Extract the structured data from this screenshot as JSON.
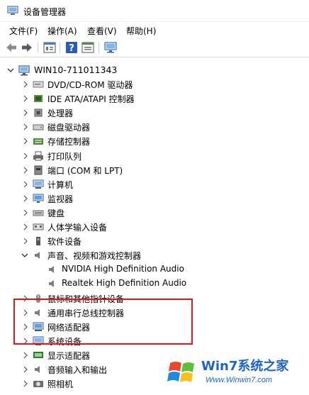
{
  "window": {
    "title": "设备管理器"
  },
  "menu": [
    "文件(F)",
    "操作(A)",
    "查看(V)",
    "帮助(H)"
  ],
  "tree": {
    "root": "WIN10-711011343",
    "items": [
      {
        "label": "DVD/CD-ROM 驱动器",
        "icon": "dvd-drive-icon"
      },
      {
        "label": "IDE ATA/ATAPI 控制器",
        "icon": "ide-controller-icon"
      },
      {
        "label": "处理器",
        "icon": "processor-icon"
      },
      {
        "label": "磁盘驱动器",
        "icon": "disk-drive-icon"
      },
      {
        "label": "存储控制器",
        "icon": "storage-controller-icon"
      },
      {
        "label": "打印队列",
        "icon": "printer-icon"
      },
      {
        "label": "端口 (COM 和 LPT)",
        "icon": "port-icon"
      },
      {
        "label": "计算机",
        "icon": "computer-icon"
      },
      {
        "label": "监视器",
        "icon": "monitor-icon"
      },
      {
        "label": "键盘",
        "icon": "keyboard-icon"
      },
      {
        "label": "人体学输入设备",
        "icon": "hid-icon"
      },
      {
        "label": "软件设备",
        "icon": "software-device-icon"
      },
      {
        "label": "声音、视频和游戏控制器",
        "icon": "speaker-icon",
        "expanded": true,
        "children": [
          "NVIDIA High Definition Audio",
          "Realtek High Definition Audio"
        ]
      },
      {
        "label": "鼠标和其他指针设备",
        "icon": "mouse-icon"
      },
      {
        "label": "通用串行总线控制器",
        "icon": "usb-icon"
      },
      {
        "label": "网络适配器",
        "icon": "network-adapter-icon"
      },
      {
        "label": "系统设备",
        "icon": "system-device-icon"
      },
      {
        "label": "显示适配器",
        "icon": "display-adapter-icon"
      },
      {
        "label": "音频输入和输出",
        "icon": "audio-io-icon"
      },
      {
        "label": "照相机",
        "icon": "camera-icon"
      }
    ]
  },
  "watermark": {
    "brand": "Win7系统之家",
    "url": "Www.Winwin7.com"
  },
  "colors": {
    "highlight_border": "#e3151b",
    "watermark_blue": "#1e63c8"
  }
}
